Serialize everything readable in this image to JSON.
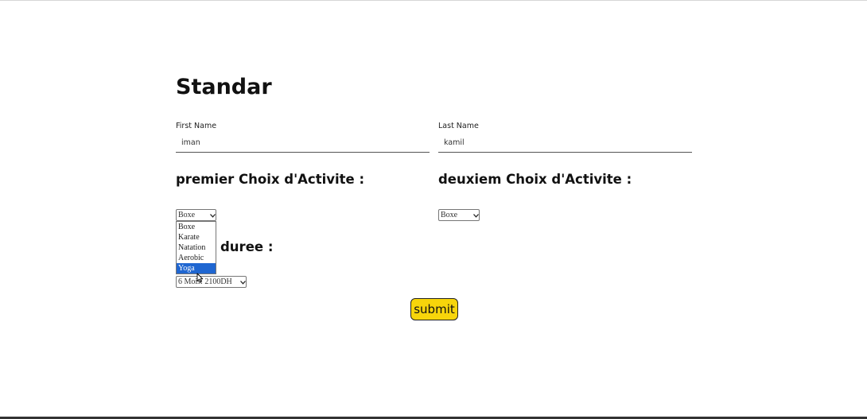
{
  "form": {
    "title": "Standar",
    "first_name": {
      "label": "First Name",
      "value": "iman"
    },
    "last_name": {
      "label": "Last Name",
      "value": "kamil"
    },
    "premier_choix": {
      "heading": "premier Choix d'Activite :",
      "selected": "Boxe",
      "options": [
        "Boxe",
        "Karate",
        "Natation",
        "Aerobic",
        "Yoga"
      ],
      "highlighted": "Yoga"
    },
    "deuxiem_choix": {
      "heading": "deuxiem Choix d'Activite :",
      "selected": "Boxe"
    },
    "duree": {
      "heading": "duree :",
      "selected": "6 Mois: 2100DH"
    },
    "submit_label": "submit"
  },
  "colors": {
    "submit_bg": "#f7d50b",
    "highlight": "#1f66d1"
  },
  "icons": {
    "select_arrow": "chevron-down-icon",
    "cursor": "mouse-pointer-icon"
  }
}
